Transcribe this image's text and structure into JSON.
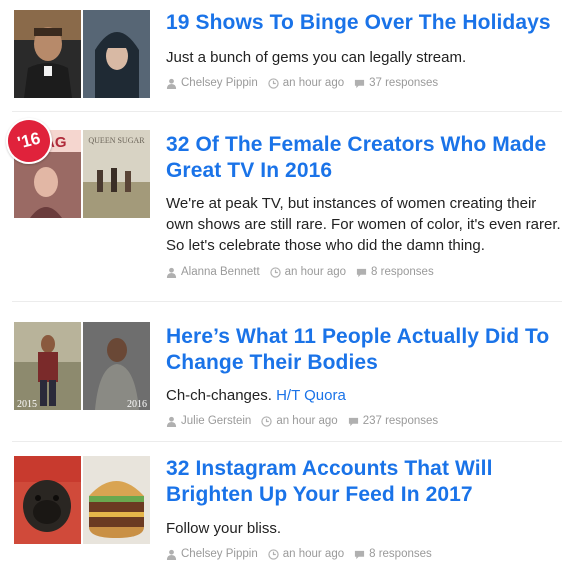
{
  "articles": [
    {
      "title": "19 Shows To Binge Over The Holidays",
      "description": "Just a bunch of gems you can legally stream.",
      "description_link": "",
      "author": "Chelsey Pippin",
      "time": "an hour ago",
      "responses": "37 responses",
      "badge": ""
    },
    {
      "title": "32 Of The Female Creators Who Made Great TV In 2016",
      "description": "We're at peak TV, but instances of women creating their own shows are still rare. For women of color, it's even rarer. So let's celebrate those who did the damn thing.",
      "description_link": "",
      "author": "Alanna Bennett",
      "time": "an hour ago",
      "responses": "8 responses",
      "badge": "'16",
      "thumb_text_left": "AG",
      "thumb_text_right": "QUEEN SUGAR"
    },
    {
      "title": "Here’s What 11 People Actually Did To Change Their Bodies",
      "description": "Ch-ch-changes.",
      "description_link": "H/T Quora",
      "author": "Julie Gerstein",
      "time": "an hour ago",
      "responses": "237 responses",
      "badge": "",
      "thumb_text_left": "2015",
      "thumb_text_right": "2016"
    },
    {
      "title": "32 Instagram Accounts That Will Brighten Up Your Feed In 2017",
      "description": "Follow your bliss.",
      "description_link": "",
      "author": "Chelsey Pippin",
      "time": "an hour ago",
      "responses": "8 responses",
      "badge": ""
    }
  ],
  "icons": {
    "author": "user-icon",
    "time": "clock-icon",
    "responses": "comment-icon"
  },
  "colors": {
    "title_link": "#1a73e8",
    "meta_text": "#9a9a9a",
    "badge": "#e0223b"
  }
}
